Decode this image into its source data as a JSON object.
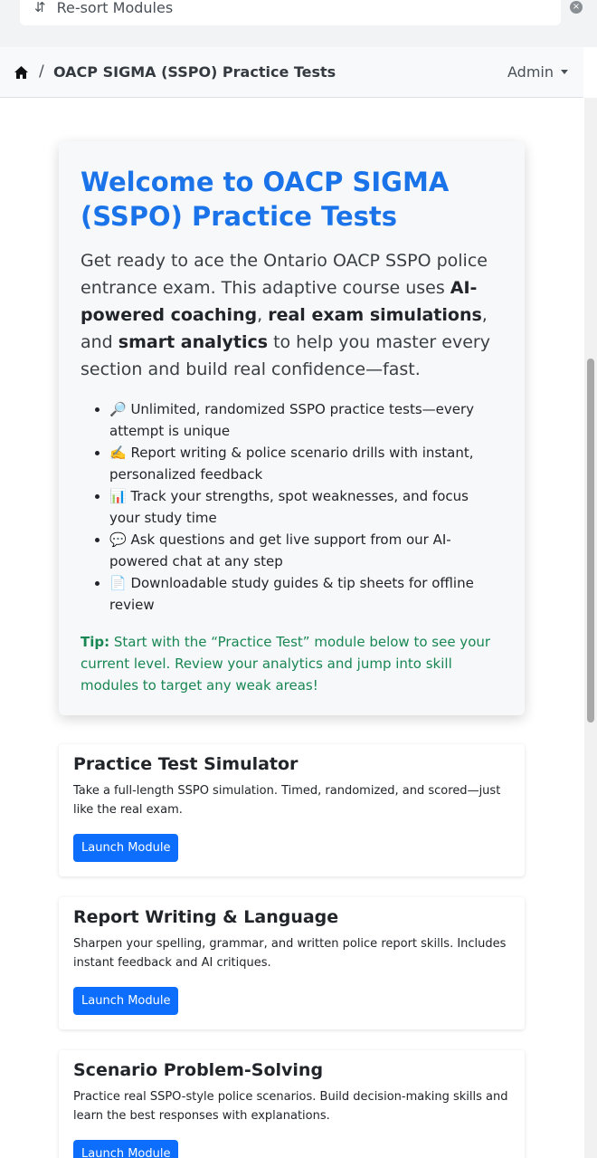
{
  "resort": {
    "label": "Re-sort Modules",
    "icon": "sort-arrows-icon"
  },
  "breadcrumb": {
    "home_icon": "home-icon",
    "separator": "/",
    "title": "OACP SIGMA (SSPO) Practice Tests"
  },
  "user_menu": {
    "label": "Admin"
  },
  "welcome": {
    "title": "Welcome to OACP SIGMA (SSPO) Practice Tests",
    "lead_1": "Get ready to ace the Ontario OACP SSPO police entrance exam. This adaptive course uses ",
    "lead_b1": "AI-powered coaching",
    "lead_2": ", ",
    "lead_b2": "real exam simulations",
    "lead_3": ", and ",
    "lead_b3": "smart analytics",
    "lead_4": " to help you master every section and build real confidence—fast.",
    "features": [
      "🔎 Unlimited, randomized SSPO practice tests—every attempt is unique",
      "✍️ Report writing & police scenario drills with instant, personalized feedback",
      "📊 Track your strengths, spot weaknesses, and focus your study time",
      "💬 Ask questions and get live support from our AI-powered chat at any step",
      "📄 Downloadable study guides & tip sheets for offline review"
    ],
    "tip_label": "Tip:",
    "tip_text": " Start with the “Practice Test” module below to see your current level. Review your analytics and jump into skill modules to target any weak areas!"
  },
  "modules": [
    {
      "title": "Practice Test Simulator",
      "description": "Take a full-length SSPO simulation. Timed, randomized, and scored—just like the real exam.",
      "button": "Launch Module"
    },
    {
      "title": "Report Writing & Language",
      "description": "Sharpen your spelling, grammar, and written police report skills. Includes instant feedback and AI critiques.",
      "button": "Launch Module"
    },
    {
      "title": "Scenario Problem-Solving",
      "description": "Practice real SSPO-style police scenarios. Build decision-making skills and learn the best responses with explanations.",
      "button": "Launch Module"
    }
  ],
  "colors": {
    "accent": "#1a73e8",
    "button": "#0d6efd",
    "tip": "#198754"
  }
}
